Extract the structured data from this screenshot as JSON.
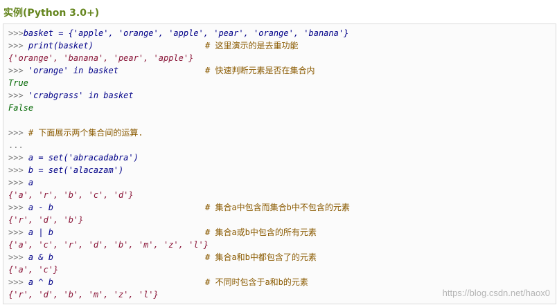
{
  "title": "实例(Python 3.0+)",
  "watermark": "https://blog.csdn.net/haox0",
  "lines": [
    {
      "code": ">>>basket = {'apple', 'orange', 'apple', 'pear', 'orange', 'banana'}",
      "comment": "",
      "style": "code"
    },
    {
      "code": ">>> print(basket)",
      "comment": "# 这里演示的是去重功能",
      "style": "code"
    },
    {
      "code": "{'orange', 'banana', 'pear', 'apple'}",
      "comment": "",
      "style": "out"
    },
    {
      "code": ">>> 'orange' in basket",
      "comment": "# 快速判断元素是否在集合内",
      "style": "code"
    },
    {
      "code": "True",
      "comment": "",
      "style": "kw"
    },
    {
      "code": ">>> 'crabgrass' in basket",
      "comment": "",
      "style": "code"
    },
    {
      "code": "False",
      "comment": "",
      "style": "kw"
    },
    {
      "code": "",
      "comment": "",
      "style": "out"
    },
    {
      "code": ">>> # 下面展示两个集合间的运算.",
      "comment": "",
      "style": "comment-line"
    },
    {
      "code": "...",
      "comment": "",
      "style": "prompt"
    },
    {
      "code": ">>> a = set('abracadabra')",
      "comment": "",
      "style": "code"
    },
    {
      "code": ">>> b = set('alacazam')",
      "comment": "",
      "style": "code"
    },
    {
      "code": ">>> a",
      "comment": "",
      "style": "code"
    },
    {
      "code": "{'a', 'r', 'b', 'c', 'd'}",
      "comment": "",
      "style": "out"
    },
    {
      "code": ">>> a - b",
      "comment": "# 集合a中包含而集合b中不包含的元素",
      "style": "code"
    },
    {
      "code": "{'r', 'd', 'b'}",
      "comment": "",
      "style": "out"
    },
    {
      "code": ">>> a | b",
      "comment": "# 集合a或b中包含的所有元素",
      "style": "code"
    },
    {
      "code": "{'a', 'c', 'r', 'd', 'b', 'm', 'z', 'l'}",
      "comment": "",
      "style": "out"
    },
    {
      "code": ">>> a & b",
      "comment": "# 集合a和b中都包含了的元素",
      "style": "code"
    },
    {
      "code": "{'a', 'c'}",
      "comment": "",
      "style": "out"
    },
    {
      "code": ">>> a ^ b",
      "comment": "# 不同时包含于a和b的元素",
      "style": "code"
    },
    {
      "code": "{'r', 'd', 'b', 'm', 'z', 'l'}",
      "comment": "",
      "style": "out"
    }
  ],
  "colors": {
    "title": "#64851d",
    "prompt": "#7b7b7b",
    "code": "#000088",
    "output": "#8a1538",
    "keyword": "#006600",
    "comment": "#8a5a00",
    "border": "#dadada",
    "background": "#fbfbfb"
  }
}
